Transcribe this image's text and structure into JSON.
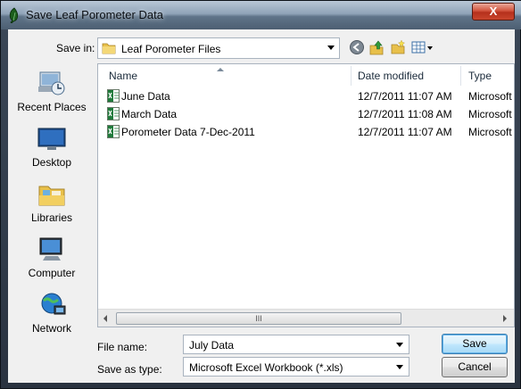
{
  "window": {
    "title": "Save Leaf Porometer Data",
    "close_label": "X"
  },
  "save_in": {
    "label": "Save in:",
    "value": "Leaf Porometer Files"
  },
  "toolbar": {
    "icons": [
      "back-icon",
      "up-folder-icon",
      "new-folder-icon",
      "view-menu-icon"
    ]
  },
  "places": [
    {
      "label": "Recent Places",
      "icon": "recent-places-icon"
    },
    {
      "label": "Desktop",
      "icon": "desktop-icon"
    },
    {
      "label": "Libraries",
      "icon": "libraries-icon"
    },
    {
      "label": "Computer",
      "icon": "computer-icon"
    },
    {
      "label": "Network",
      "icon": "network-icon"
    }
  ],
  "file_list": {
    "columns": [
      "Name",
      "Date modified",
      "Type"
    ],
    "files": [
      {
        "name": "June Data",
        "date": "12/7/2011 11:07 AM",
        "type": "Microsoft"
      },
      {
        "name": "March Data",
        "date": "12/7/2011 11:08 AM",
        "type": "Microsoft"
      },
      {
        "name": "Porometer Data 7-Dec-2011",
        "date": "12/7/2011 11:07 AM",
        "type": "Microsoft"
      }
    ],
    "scroll_grip": "III"
  },
  "file_name": {
    "label": "File name:",
    "value": "July Data"
  },
  "save_type": {
    "label": "Save as type:",
    "value": "Microsoft Excel Workbook (*.xls)"
  },
  "buttons": {
    "save": "Save",
    "cancel": "Cancel"
  },
  "colors": {
    "excel_green": "#1f7a3a",
    "folder_yellow": "#e8c04a",
    "accent_blue": "#3c7fb1"
  }
}
